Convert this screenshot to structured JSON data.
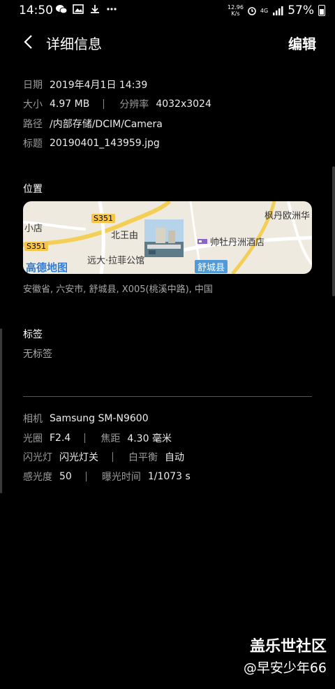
{
  "status": {
    "time": "14:50",
    "net_speed_top": "12.96",
    "net_speed_bottom": "K/s",
    "network": "4G",
    "battery": "57%"
  },
  "header": {
    "title": "详细信息",
    "edit": "编辑"
  },
  "info": {
    "date_label": "日期",
    "date_value": "2019年4月1日 14:39",
    "size_label": "大小",
    "size_value": "4.97 MB",
    "resolution_label": "分辨率",
    "resolution_value": "4032x3024",
    "path_label": "路径",
    "path_value": "/内部存储/DCIM/Camera",
    "title_label": "标题",
    "title_value": "20190401_143959.jpg"
  },
  "location": {
    "section_title": "位置",
    "map": {
      "labels": {
        "top_right": "枫丹欧洲华",
        "top_left": "小店",
        "road_top": "S351",
        "middle": "北王由",
        "road_left": "S351",
        "hotel": "帅牡丹洲酒店",
        "bottom_mid": "远大·拉菲公馆",
        "logo": "高德地图",
        "county": "舒城县"
      }
    },
    "address": "安徽省, 六安市, 舒城县, X005(桃溪中路), 中国"
  },
  "tags": {
    "section_title": "标签",
    "value": "无标签"
  },
  "camera": {
    "camera_label": "相机",
    "camera_value": "Samsung SM-N9600",
    "aperture_label": "光圈",
    "aperture_value": "F2.4",
    "focal_label": "焦距",
    "focal_value": "4.30 毫米",
    "flash_label": "闪光灯",
    "flash_value": "闪光灯关",
    "wb_label": "白平衡",
    "wb_value": "自动",
    "iso_label": "感光度",
    "iso_value": "50",
    "exposure_label": "曝光时间",
    "exposure_value": "1/1073 s"
  },
  "watermark": {
    "line1": "盖乐世社区",
    "line2": "@早安少年66"
  }
}
